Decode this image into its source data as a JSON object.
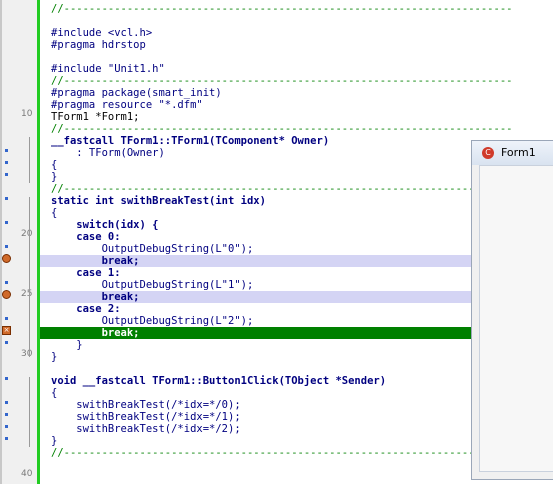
{
  "editor": {
    "lines": [
      "//-----------------------------------------------------------------------",
      "",
      "#include <vcl.h>",
      "#pragma hdrstop",
      "",
      "#include \"Unit1.h\"",
      "//-----------------------------------------------------------------------",
      "#pragma package(smart_init)",
      "#pragma resource \"*.dfm\"",
      "TForm1 *Form1;",
      "//-----------------------------------------------------------------------",
      "__fastcall TForm1::TForm1(TComponent* Owner)",
      "    : TForm(Owner)",
      "{",
      "}",
      "//-----------------------------------------------------------------------",
      "static int swithBreakTest(int idx)",
      "{",
      "    switch(idx) {",
      "    case 0:",
      "        OutputDebugString(L\"0\");",
      "        break;",
      "    case 1:",
      "        OutputDebugString(L\"1\");",
      "        break;",
      "    case 2:",
      "        OutputDebugString(L\"2\");",
      "        break;",
      "    }",
      "}",
      "",
      "void __fastcall TForm1::Button1Click(TObject *Sender)",
      "{",
      "    swithBreakTest(/*idx=*/0);",
      "    swithBreakTest(/*idx=*/1);",
      "    swithBreakTest(/*idx=*/2);",
      "}",
      "//-----------------------------------------------------------------------",
      "",
      ""
    ],
    "line_numbers": [
      "10",
      "20",
      "25",
      "30",
      "40"
    ]
  },
  "form_window": {
    "title": "Form1",
    "icon": "cbuilder-app-icon"
  },
  "colors": {
    "breakpoint_line": "#d4d4f4",
    "execution_line": "#008000",
    "change_bar": "#22cc22",
    "comment": "#008000",
    "code": "#000080"
  }
}
